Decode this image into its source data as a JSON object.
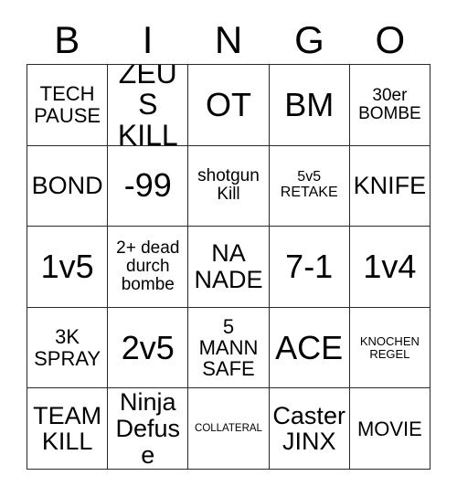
{
  "card": {
    "title": "BINGO",
    "header_letters": [
      "B",
      "I",
      "N",
      "G",
      "O"
    ],
    "border_color": "#2b2b2b",
    "background_color": "#ffffff",
    "text_color": "#000000",
    "columns": 5,
    "rows": 5
  },
  "cells": [
    {
      "text": "TECH\nPAUSE",
      "size": "fs-md"
    },
    {
      "text": "ZEUS\nKILL",
      "size": "fs-xl"
    },
    {
      "text": "OT",
      "size": "fs-xxl"
    },
    {
      "text": "BM",
      "size": "fs-xxl"
    },
    {
      "text": "30er\nBOMBE",
      "size": "fs-sm"
    },
    {
      "text": "BOND",
      "size": "fs-lg"
    },
    {
      "text": "-99",
      "size": "fs-xxl"
    },
    {
      "text": "shotgun\nKill",
      "size": "fs-sm"
    },
    {
      "text": "5v5\nRETAKE",
      "size": "fs-xs"
    },
    {
      "text": "KNIFE",
      "size": "fs-lg"
    },
    {
      "text": "1v5",
      "size": "fs-xxl"
    },
    {
      "text": "2+ dead\ndurch\nbombe",
      "size": "fs-sm"
    },
    {
      "text": "NA\nNADE",
      "size": "fs-lg"
    },
    {
      "text": "7-1",
      "size": "fs-xxl"
    },
    {
      "text": "1v4",
      "size": "fs-xxl"
    },
    {
      "text": "3K\nSPRAY",
      "size": "fs-md"
    },
    {
      "text": "2v5",
      "size": "fs-xxl"
    },
    {
      "text": "5\nMANN\nSAFE",
      "size": "fs-md"
    },
    {
      "text": "ACE",
      "size": "fs-xxl"
    },
    {
      "text": "KNOCHEN\nREGEL",
      "size": "fs-xxs"
    },
    {
      "text": "TEAM\nKILL",
      "size": "fs-lg"
    },
    {
      "text": "Ninja\nDefuse",
      "size": "fs-lg"
    },
    {
      "text": "COLLATERAL",
      "size": "fs-tiny"
    },
    {
      "text": "Caster\nJINX",
      "size": "fs-lg"
    },
    {
      "text": "MOVIE",
      "size": "fs-md"
    }
  ]
}
